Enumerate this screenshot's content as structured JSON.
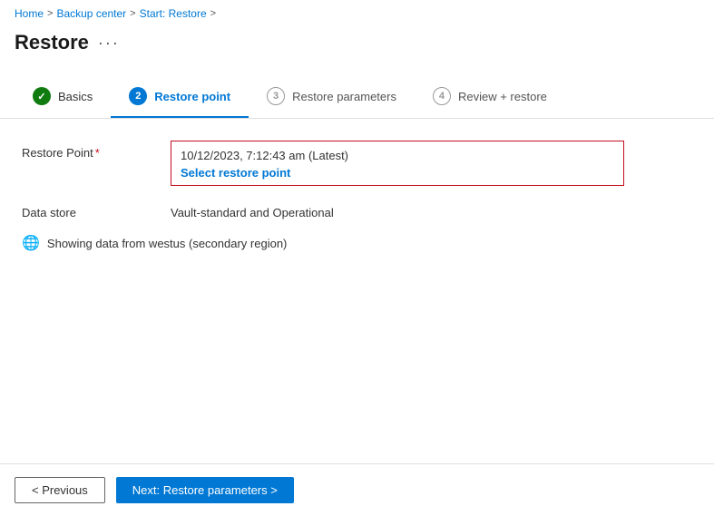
{
  "breadcrumb": {
    "home": "Home",
    "backup_center": "Backup center",
    "start_restore": "Start: Restore",
    "sep": ">"
  },
  "page": {
    "title": "Restore",
    "more_label": "···"
  },
  "tabs": [
    {
      "id": "basics",
      "label": "Basics",
      "number": "1",
      "state": "done"
    },
    {
      "id": "restore-point",
      "label": "Restore point",
      "number": "2",
      "state": "active"
    },
    {
      "id": "restore-parameters",
      "label": "Restore parameters",
      "number": "3",
      "state": "inactive"
    },
    {
      "id": "review-restore",
      "label": "Review + restore",
      "number": "4",
      "state": "inactive"
    }
  ],
  "form": {
    "restore_point_label": "Restore Point",
    "restore_point_value": "10/12/2023, 7:12:43 am (Latest)",
    "select_link": "Select restore point",
    "data_store_label": "Data store",
    "data_store_value": "Vault-standard and Operational",
    "info_text": "Showing data from westus (secondary region)"
  },
  "footer": {
    "prev_label": "< Previous",
    "next_label": "Next: Restore parameters >"
  },
  "icons": {
    "globe": "🌐",
    "checkmark": "✓"
  }
}
